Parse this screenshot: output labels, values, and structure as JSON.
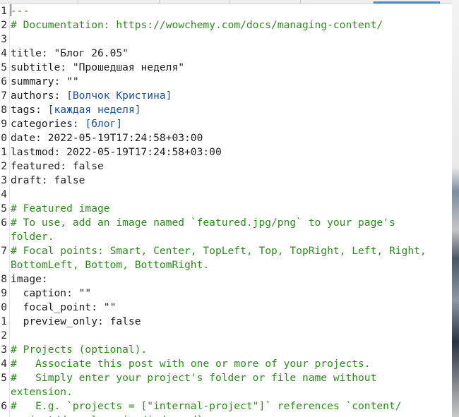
{
  "editor": {
    "lines": [
      {
        "n": "1",
        "parts": [
          {
            "t": "---",
            "c": "c-comment"
          }
        ],
        "cursor": true
      },
      {
        "n": "2",
        "parts": [
          {
            "t": "# Documentation: https://wowchemy.com/docs/managing-content/",
            "c": "c-comment"
          }
        ]
      },
      {
        "n": "3",
        "parts": [
          {
            "t": "",
            "c": "c-str"
          }
        ]
      },
      {
        "n": "4",
        "parts": [
          {
            "t": "title: \"Блог 26.05\"",
            "c": "c-str"
          }
        ]
      },
      {
        "n": "5",
        "parts": [
          {
            "t": "subtitle: \"Прошедшая неделя\"",
            "c": "c-str"
          }
        ]
      },
      {
        "n": "6",
        "parts": [
          {
            "t": "summary: \"\"",
            "c": "c-str"
          }
        ]
      },
      {
        "n": "7",
        "parts": [
          {
            "t": "authors: ",
            "c": "c-str"
          },
          {
            "t": "[Волчок Кристина]",
            "c": "c-list"
          }
        ]
      },
      {
        "n": "8",
        "parts": [
          {
            "t": "tags: ",
            "c": "c-str"
          },
          {
            "t": "[каждая неделя]",
            "c": "c-list"
          }
        ]
      },
      {
        "n": "9",
        "parts": [
          {
            "t": "categories: ",
            "c": "c-str"
          },
          {
            "t": "[блог]",
            "c": "c-list"
          }
        ]
      },
      {
        "n": "0",
        "parts": [
          {
            "t": "date: 2022-05-19T17:24:58+03:00",
            "c": "c-str"
          }
        ]
      },
      {
        "n": "1",
        "parts": [
          {
            "t": "lastmod: 2022-05-19T17:24:58+03:00",
            "c": "c-str"
          }
        ]
      },
      {
        "n": "2",
        "parts": [
          {
            "t": "featured: false",
            "c": "c-str"
          }
        ]
      },
      {
        "n": "3",
        "parts": [
          {
            "t": "draft: false",
            "c": "c-str"
          }
        ]
      },
      {
        "n": "4",
        "parts": [
          {
            "t": "",
            "c": "c-str"
          }
        ]
      },
      {
        "n": "5",
        "parts": [
          {
            "t": "# Featured image",
            "c": "c-comment"
          }
        ]
      },
      {
        "n": "6",
        "parts": [
          {
            "t": "# To use, add an image named `featured.jpg/png` to your page's",
            "c": "c-comment"
          }
        ]
      },
      {
        "n": "",
        "parts": [
          {
            "t": "folder.",
            "c": "c-comment"
          }
        ]
      },
      {
        "n": "7",
        "parts": [
          {
            "t": "# Focal points: Smart, Center, TopLeft, Top, TopRight, Left, Right,",
            "c": "c-comment"
          }
        ]
      },
      {
        "n": "",
        "parts": [
          {
            "t": "BottomLeft, Bottom, BottomRight.",
            "c": "c-comment"
          }
        ]
      },
      {
        "n": "8",
        "parts": [
          {
            "t": "image:",
            "c": "c-str"
          }
        ]
      },
      {
        "n": "9",
        "parts": [
          {
            "t": "  caption: \"\"",
            "c": "c-str"
          }
        ]
      },
      {
        "n": "0",
        "parts": [
          {
            "t": "  focal_point: \"\"",
            "c": "c-str"
          }
        ]
      },
      {
        "n": "1",
        "parts": [
          {
            "t": "  preview_only: false",
            "c": "c-str"
          }
        ]
      },
      {
        "n": "2",
        "parts": [
          {
            "t": "",
            "c": "c-str"
          }
        ]
      },
      {
        "n": "3",
        "parts": [
          {
            "t": "# Projects (optional).",
            "c": "c-comment"
          }
        ]
      },
      {
        "n": "4",
        "parts": [
          {
            "t": "#   Associate this post with one or more of your projects.",
            "c": "c-comment"
          }
        ]
      },
      {
        "n": "5",
        "parts": [
          {
            "t": "#   Simply enter your project's folder or file name without",
            "c": "c-comment"
          }
        ]
      },
      {
        "n": "",
        "parts": [
          {
            "t": "extension.",
            "c": "c-comment"
          }
        ]
      },
      {
        "n": "6",
        "parts": [
          {
            "t": "#   E.g. `projects = [\"internal-project\"]` references `content/",
            "c": "c-comment"
          }
        ]
      },
      {
        "n": "",
        "parts": [
          {
            "t": "project/deep-learning/index.md`.",
            "c": "c-comment"
          }
        ]
      }
    ]
  },
  "colors": {
    "comment": "#2e8b1f",
    "list": "#1d4fa0",
    "text": "#1e1e1e",
    "tab_active": "#4a90c2"
  }
}
